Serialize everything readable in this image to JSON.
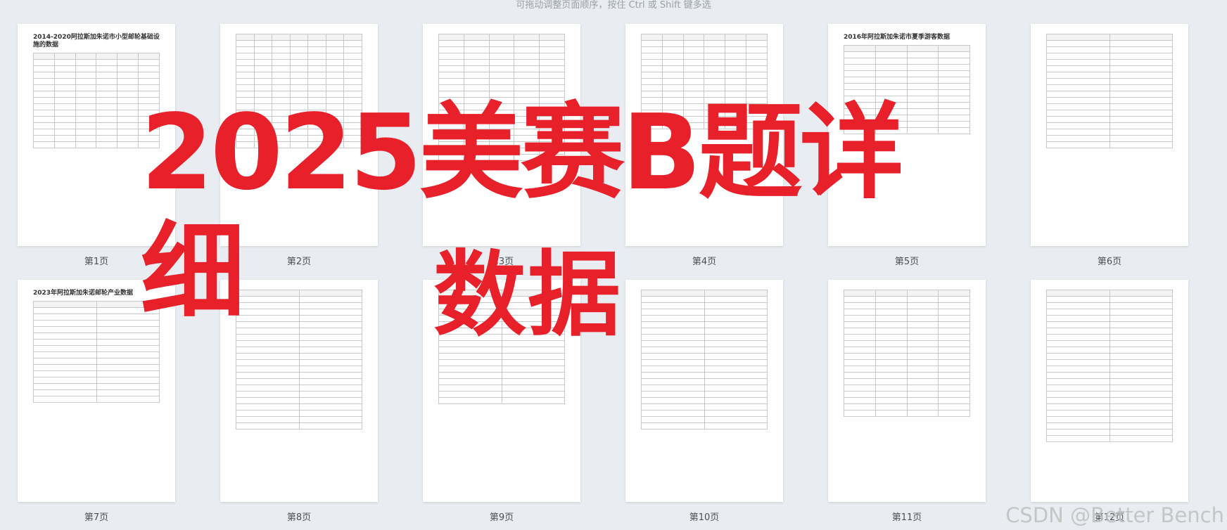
{
  "hint": "可拖动调整页面顺序，按住 Ctrl 或 Shift 键多选",
  "overlay": {
    "line1": "2025美赛B题详细",
    "line2": "数据"
  },
  "watermark": "CSDN @Better Bench",
  "pages": [
    {
      "label": "第1页",
      "title": "2014-2020阿拉斯加朱诺市小型邮轮基础设施的数据",
      "rows": 15,
      "cols": 6
    },
    {
      "label": "第2页",
      "title": "",
      "rows": 18,
      "cols": 7
    },
    {
      "label": "第3页",
      "title": "",
      "rows": 20,
      "cols": 5
    },
    {
      "label": "第4页",
      "title": "",
      "rows": 15,
      "cols": 6
    },
    {
      "label": "第5页",
      "title": "2016年阿拉斯加朱诺市夏季游客数据",
      "rows": 14,
      "cols": 4
    },
    {
      "label": "第6页",
      "title": "",
      "rows": 18,
      "cols": 2
    },
    {
      "label": "第7页",
      "title": "2023年阿拉斯加朱诺邮轮产业数据",
      "rows": 16,
      "cols": 2
    },
    {
      "label": "第8页",
      "title": "",
      "rows": 22,
      "cols": 2
    },
    {
      "label": "第9页",
      "title": "",
      "rows": 18,
      "cols": 2
    },
    {
      "label": "第10页",
      "title": "",
      "rows": 22,
      "cols": 2
    },
    {
      "label": "第11页",
      "title": "",
      "rows": 20,
      "cols": 4
    },
    {
      "label": "第12页",
      "title": "",
      "rows": 24,
      "cols": 2
    }
  ],
  "colors": {
    "overlay": "#e8202a",
    "background": "#e9ecf1",
    "page": "#ffffff"
  }
}
